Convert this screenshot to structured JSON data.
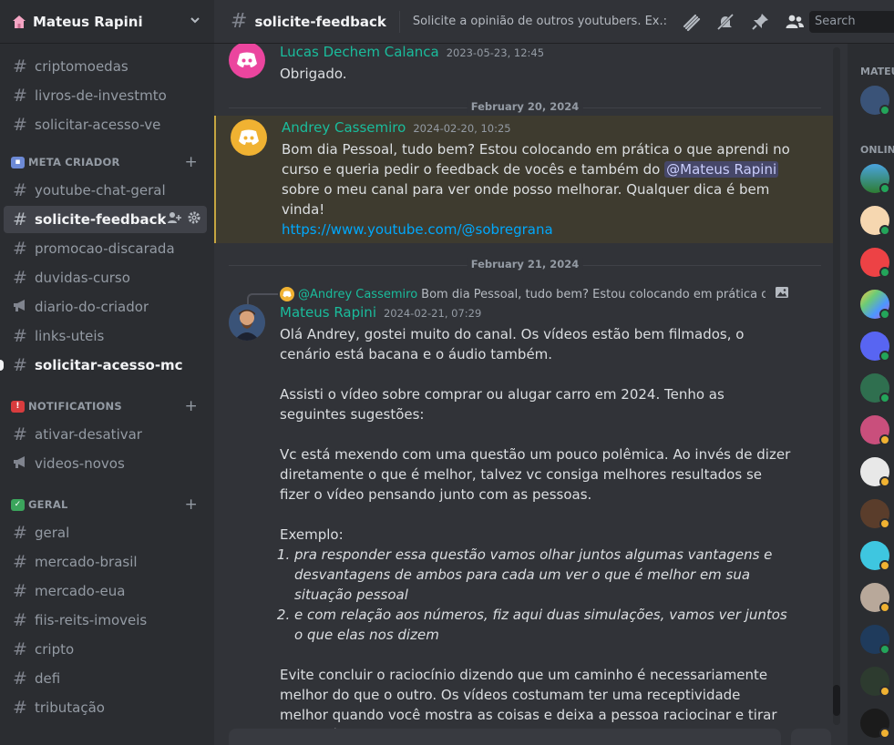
{
  "server": {
    "name": "Mateus Rapini"
  },
  "channels_top": [
    {
      "name": "criptomoedas",
      "type": "text"
    },
    {
      "name": "livros-de-investmto",
      "type": "text"
    },
    {
      "name": "solicitar-acesso-ve",
      "type": "text"
    }
  ],
  "categories": [
    {
      "name": "META CRIADOR",
      "emoji_color": "#6d8ad6",
      "channels": [
        {
          "name": "youtube-chat-geral",
          "type": "text"
        },
        {
          "name": "solicite-feedback",
          "type": "text",
          "selected": true
        },
        {
          "name": "promocao-discarada",
          "type": "text"
        },
        {
          "name": "duvidas-curso",
          "type": "text"
        },
        {
          "name": "diario-do-criador",
          "type": "announcement"
        },
        {
          "name": "links-uteis",
          "type": "text"
        },
        {
          "name": "solicitar-acesso-mc",
          "type": "text",
          "unread": true
        }
      ]
    },
    {
      "name": "NOTIFICATIONS",
      "emoji_color": "#d83c3e",
      "channels": [
        {
          "name": "ativar-desativar",
          "type": "text"
        },
        {
          "name": "videos-novos",
          "type": "announcement"
        }
      ]
    },
    {
      "name": "GERAL",
      "emoji_color": "#3ba55c",
      "emoji": "✓",
      "channels": [
        {
          "name": "geral",
          "type": "text"
        },
        {
          "name": "mercado-brasil",
          "type": "text"
        },
        {
          "name": "mercado-eua",
          "type": "text"
        },
        {
          "name": "fiis-reits-imoveis",
          "type": "text"
        },
        {
          "name": "cripto",
          "type": "text"
        },
        {
          "name": "defi",
          "type": "text"
        },
        {
          "name": "tributação",
          "type": "text"
        }
      ]
    }
  ],
  "header": {
    "channel": "solicite-feedback",
    "topic": "Solicite a opinião de outros youtubers. Ex.: v...",
    "search_placeholder": "Search"
  },
  "messages": {
    "m1": {
      "author": "Lucas Dechem Calanca",
      "timestamp": "2023-05-23, 12:45",
      "text": "Obrigado."
    },
    "divider1": "February 20, 2024",
    "m2": {
      "author": "Andrey Cassemiro",
      "timestamp": "2024-02-20, 10:25",
      "text_a": "Bom dia Pessoal, tudo bem?  Estou colocando em prática o que aprendi no curso e queria pedir o feedback de vocês e também do ",
      "mention": "@Mateus Rapini",
      "text_b": " sobre o meu canal para ver onde posso melhorar. Qualquer dica é bem vinda!",
      "link": "https://www.youtube.com/@sobregrana"
    },
    "divider2": "February 21, 2024",
    "m3": {
      "reply_author": "@Andrey Cassemiro",
      "reply_text": "Bom dia Pessoal, tudo bem?  Estou colocando em prática o que ...",
      "author": "Mateus Rapini",
      "timestamp": "2024-02-21, 07:29",
      "p1": "Olá Andrey, gostei muito do canal. Os vídeos estão bem filmados, o cenário está bacana e o áudio também.",
      "p2": "Assisti o vídeo sobre comprar ou alugar carro em 2024. Tenho as seguintes sugestões:",
      "p3": "Vc está mexendo com uma questão um pouco polêmica. Ao invés de dizer diretamente o que é melhor, talvez vc consiga melhores resultados se fizer o vídeo pensando junto com as pessoas.",
      "p4": "Exemplo:",
      "li1": "pra responder essa questão vamos olhar juntos algumas vantagens e desvantagens de ambos para cada um ver o que é melhor em sua situação pessoal",
      "li2": "e com relação aos números, fiz aqui duas simulações, vamos ver juntos o que elas nos dizem",
      "p5": "Evite concluir o raciocínio dizendo que um caminho é necessariamente melhor do que o outro. Os vídeos costumam ter uma receptividade melhor quando você mostra as coisas e deixa a pessoa raciocinar e tirar suas próprias conclusões."
    }
  },
  "members": {
    "cat1": "MATEU",
    "cat2": "ONLIN"
  },
  "colors": {
    "author_teal": "#1abc9c",
    "highlight_bg": "#3e3b2f",
    "mention": "#5865f2",
    "link": "#00a8fc",
    "online": "#23a55a",
    "idle": "#f0b232"
  }
}
